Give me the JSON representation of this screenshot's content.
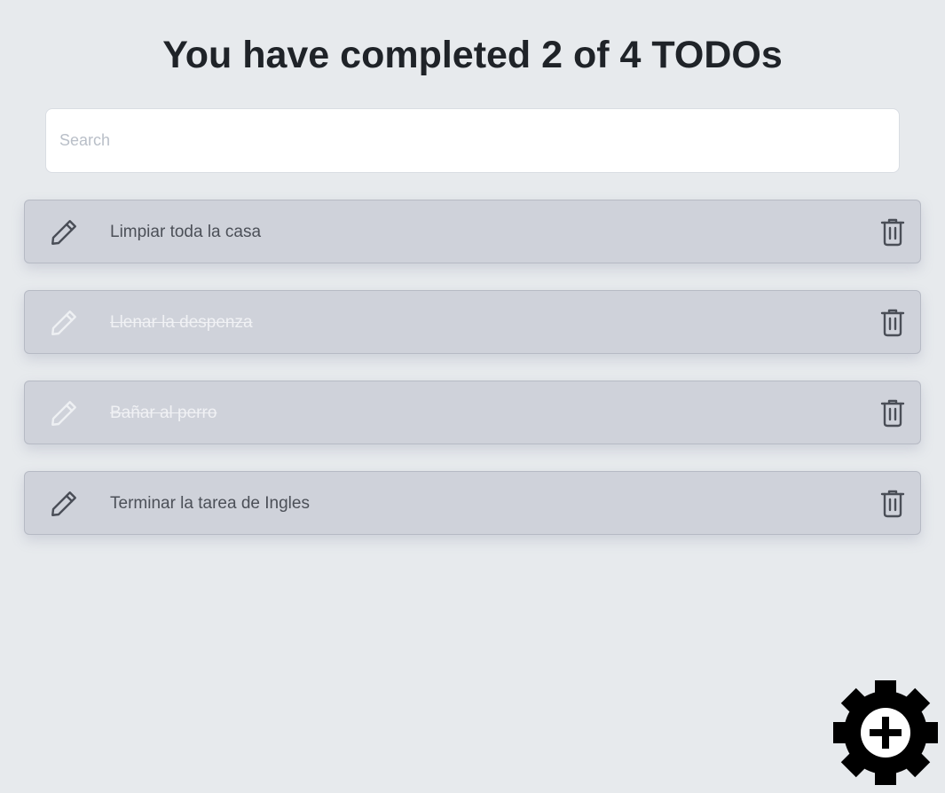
{
  "header": {
    "title": "You have completed 2 of 4 TODOs"
  },
  "search": {
    "placeholder": "Search",
    "value": ""
  },
  "todos": [
    {
      "text": "Limpiar toda la casa",
      "completed": false
    },
    {
      "text": "Llenar la despenza",
      "completed": true
    },
    {
      "text": "Bañar al perro",
      "completed": true
    },
    {
      "text": "Terminar la tarea de Ingles",
      "completed": false
    }
  ],
  "icons": {
    "edit": "pencil-icon",
    "delete": "trash-icon",
    "add": "gear-plus-icon"
  },
  "colors": {
    "background": "#e7eaed",
    "item_background": "#cfd2da",
    "text": "#4c5058",
    "completed_text": "#f0f1f4",
    "icon_active": "#4a4e57",
    "icon_completed": "#eef0f3"
  }
}
